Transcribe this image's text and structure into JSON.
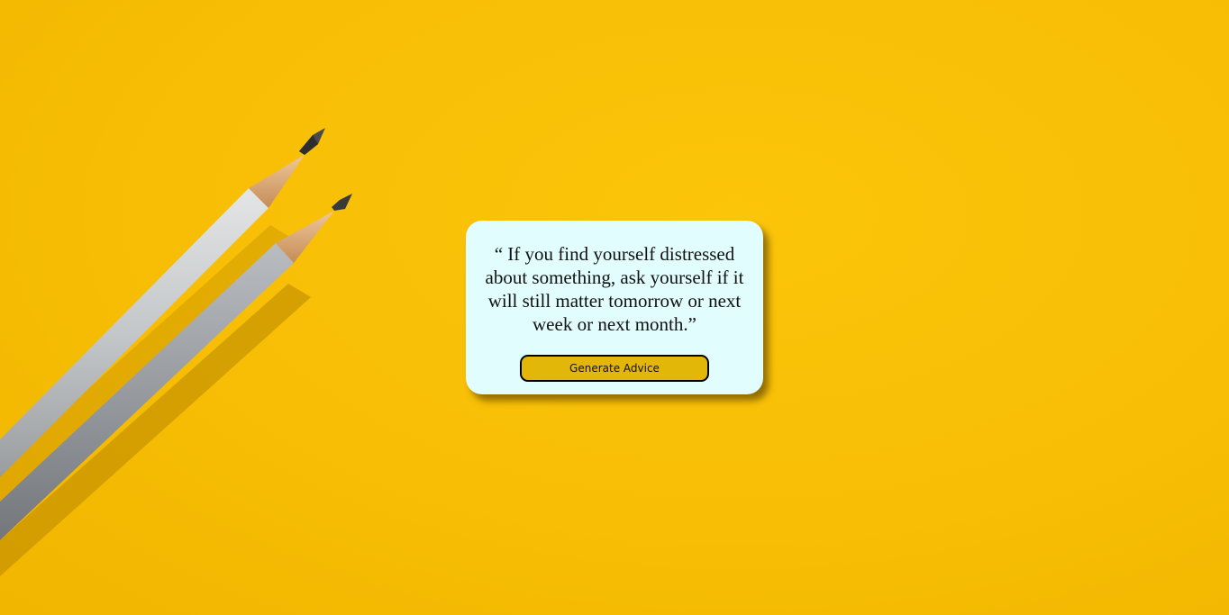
{
  "advice": {
    "quote": "“ If you find yourself distressed about something, ask yourself if it will still matter tomorrow or next week or next month.”"
  },
  "button": {
    "label": "Generate Advice"
  },
  "colors": {
    "background": "#f7be05",
    "card": "#e1fdfd",
    "button": "#e2b708"
  },
  "decoration": {
    "background_image": "two-pencils"
  }
}
